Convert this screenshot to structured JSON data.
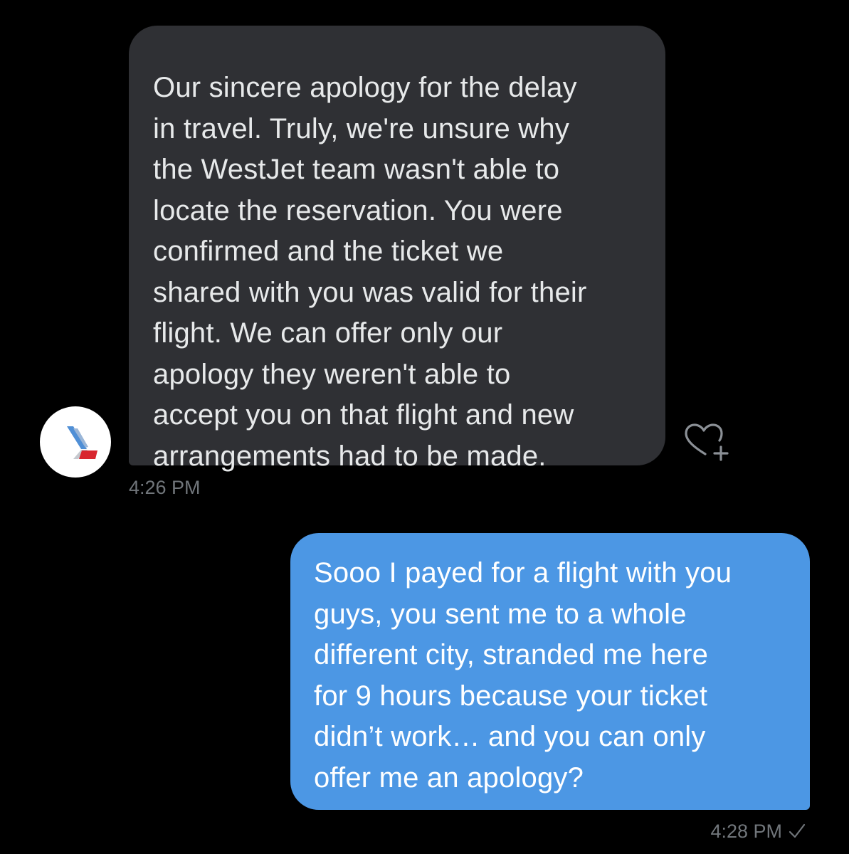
{
  "conversation": {
    "incoming": {
      "lines": [
        "Our sincere apology for the delay",
        "in travel. Truly, we're unsure why",
        "the WestJet team wasn't able to",
        "locate the reservation. You were",
        "confirmed and the ticket we",
        "shared with you was valid for their",
        "flight. We can offer only our",
        "apology they weren't able to",
        "accept you on that flight and new",
        "arrangements had to be made."
      ],
      "time": "4:26 PM",
      "avatar_icon": "american-airlines-logo-icon",
      "reaction_icon": "heart-plus-icon"
    },
    "outgoing": {
      "lines": [
        "Sooo I payed for a flight with you",
        "guys, you sent me to a whole",
        "different city, stranded me here",
        "for 9 hours because your ticket",
        "didn’t work… and you can only",
        "offer me an apology?"
      ],
      "time": "4:28 PM",
      "status_icon": "checkmark-icon"
    }
  },
  "colors": {
    "background": "#000000",
    "incoming_bubble": "#2f3034",
    "outgoing_bubble": "#4c97e4",
    "timestamp": "#71767b"
  }
}
